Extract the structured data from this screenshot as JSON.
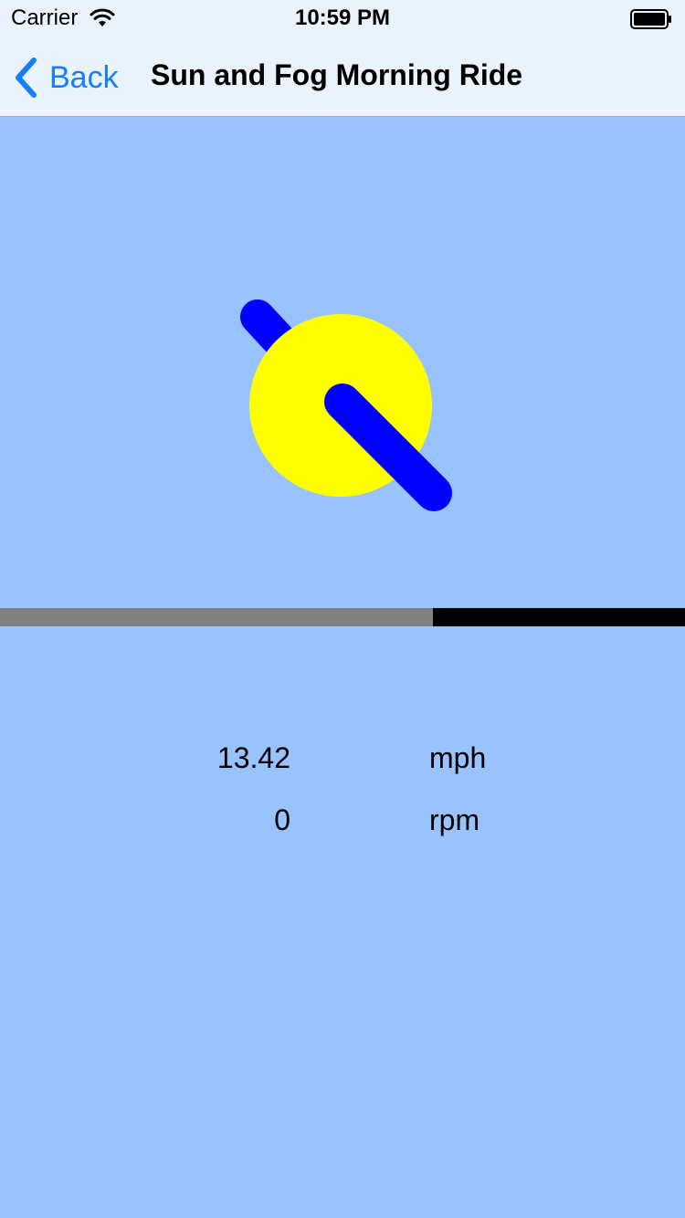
{
  "status_bar": {
    "carrier": "Carrier",
    "time": "10:59 PM",
    "wifi_icon": "wifi-icon",
    "battery_icon": "battery-icon"
  },
  "nav": {
    "back_label": "Back",
    "back_icon": "chevron-left-icon",
    "title": "Sun and Fog Morning Ride"
  },
  "colors": {
    "background": "#99C3FF",
    "bar": "#F0F6FD",
    "accent": "#147EFB",
    "wheel": "#FFFF00",
    "crank": "#0000FF",
    "progress_fill": "#808080",
    "progress_track": "#000000"
  },
  "progress": {
    "fraction": 0.632
  },
  "stats": {
    "speed": {
      "value": "13.42",
      "unit": "mph"
    },
    "cadence": {
      "value": "0",
      "unit": "rpm"
    }
  }
}
